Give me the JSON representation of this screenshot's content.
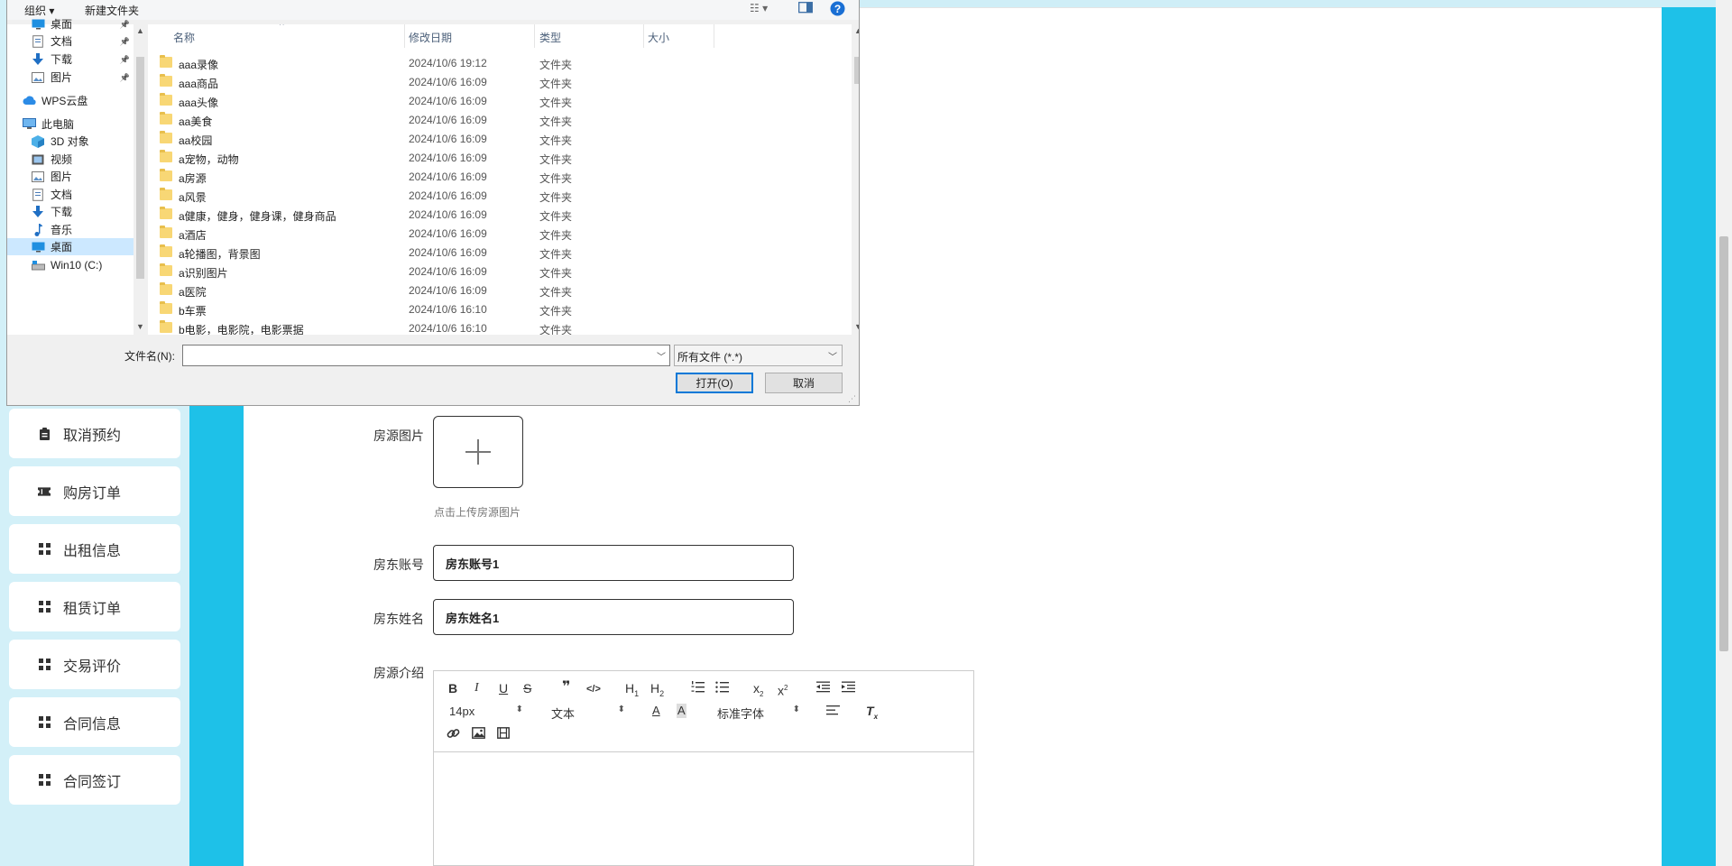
{
  "sidebar": {
    "items": [
      {
        "label": "取消预约",
        "icon": "clipboard-icon"
      },
      {
        "label": "购房订单",
        "icon": "ticket-icon"
      },
      {
        "label": "出租信息",
        "icon": "grid-icon"
      },
      {
        "label": "租赁订单",
        "icon": "grid-icon"
      },
      {
        "label": "交易评价",
        "icon": "grid-icon"
      },
      {
        "label": "合同信息",
        "icon": "grid-icon"
      },
      {
        "label": "合同签订",
        "icon": "grid-icon"
      }
    ]
  },
  "form": {
    "image_label": "房源图片",
    "upload_hint": "点击上传房源图片",
    "landlord_account_label": "房东账号",
    "landlord_account_value": "房东账号1",
    "landlord_name_label": "房东姓名",
    "landlord_name_value": "房东姓名1",
    "intro_label": "房源介绍"
  },
  "editor": {
    "font_size": "14px",
    "block_format": "文本",
    "font_family": "标准字体",
    "buttons": [
      "B",
      "I",
      "U",
      "S",
      "❞",
      "</>",
      "H1",
      "H2",
      "ordered-list",
      "bullet-list",
      "x₂",
      "x²",
      "outdent",
      "indent",
      "A",
      "A-bg",
      "align",
      "Tx",
      "link",
      "image",
      "video"
    ]
  },
  "dialog": {
    "toolbar": {
      "organize": "组织 ▾",
      "new_folder": "新建文件夹"
    },
    "nav": [
      {
        "label": "桌面",
        "icon": "desktop-icon",
        "pinned": true
      },
      {
        "label": "文档",
        "icon": "documents-icon",
        "pinned": true
      },
      {
        "label": "下载",
        "icon": "download-icon",
        "pinned": true
      },
      {
        "label": "图片",
        "icon": "pictures-icon",
        "pinned": true
      },
      {
        "label": "WPS云盘",
        "icon": "cloud-icon",
        "pinned": false
      },
      {
        "label": "此电脑",
        "icon": "computer-icon",
        "pinned": false
      },
      {
        "label": "3D 对象",
        "icon": "3d-objects-icon",
        "pinned": false
      },
      {
        "label": "视频",
        "icon": "videos-icon",
        "pinned": false
      },
      {
        "label": "图片",
        "icon": "pictures-icon",
        "pinned": false
      },
      {
        "label": "文档",
        "icon": "documents-icon",
        "pinned": false
      },
      {
        "label": "下载",
        "icon": "download-icon",
        "pinned": false
      },
      {
        "label": "音乐",
        "icon": "music-icon",
        "pinned": false
      },
      {
        "label": "桌面",
        "icon": "desktop-icon",
        "pinned": false,
        "selected": true
      },
      {
        "label": "Win10 (C:)",
        "icon": "drive-icon",
        "pinned": false
      }
    ],
    "columns": {
      "name": "名称",
      "date": "修改日期",
      "type": "类型",
      "size": "大小"
    },
    "files": [
      {
        "name": "aaa录像",
        "date": "2024/10/6 19:12",
        "type": "文件夹"
      },
      {
        "name": "aaa商品",
        "date": "2024/10/6 16:09",
        "type": "文件夹"
      },
      {
        "name": "aaa头像",
        "date": "2024/10/6 16:09",
        "type": "文件夹"
      },
      {
        "name": "aa美食",
        "date": "2024/10/6 16:09",
        "type": "文件夹"
      },
      {
        "name": "aa校园",
        "date": "2024/10/6 16:09",
        "type": "文件夹"
      },
      {
        "name": "a宠物，动物",
        "date": "2024/10/6 16:09",
        "type": "文件夹"
      },
      {
        "name": "a房源",
        "date": "2024/10/6 16:09",
        "type": "文件夹"
      },
      {
        "name": "a风景",
        "date": "2024/10/6 16:09",
        "type": "文件夹"
      },
      {
        "name": "a健康，健身，健身课，健身商品",
        "date": "2024/10/6 16:09",
        "type": "文件夹"
      },
      {
        "name": "a酒店",
        "date": "2024/10/6 16:09",
        "type": "文件夹"
      },
      {
        "name": "a轮播图，背景图",
        "date": "2024/10/6 16:09",
        "type": "文件夹"
      },
      {
        "name": "a识别图片",
        "date": "2024/10/6 16:09",
        "type": "文件夹"
      },
      {
        "name": "a医院",
        "date": "2024/10/6 16:09",
        "type": "文件夹"
      },
      {
        "name": "b车票",
        "date": "2024/10/6 16:10",
        "type": "文件夹"
      },
      {
        "name": "b电影，电影院，电影票据",
        "date": "2024/10/6 16:10",
        "type": "文件夹"
      }
    ],
    "filename_label": "文件名(N):",
    "filename_value": "",
    "filetype": "所有文件 (*.*)",
    "open_button": "打开(O)",
    "cancel_button": "取消"
  },
  "colors": {
    "accent": "#1ec1e8",
    "sidebar_bg": "#d3f0f8",
    "selection": "#cce8ff"
  }
}
